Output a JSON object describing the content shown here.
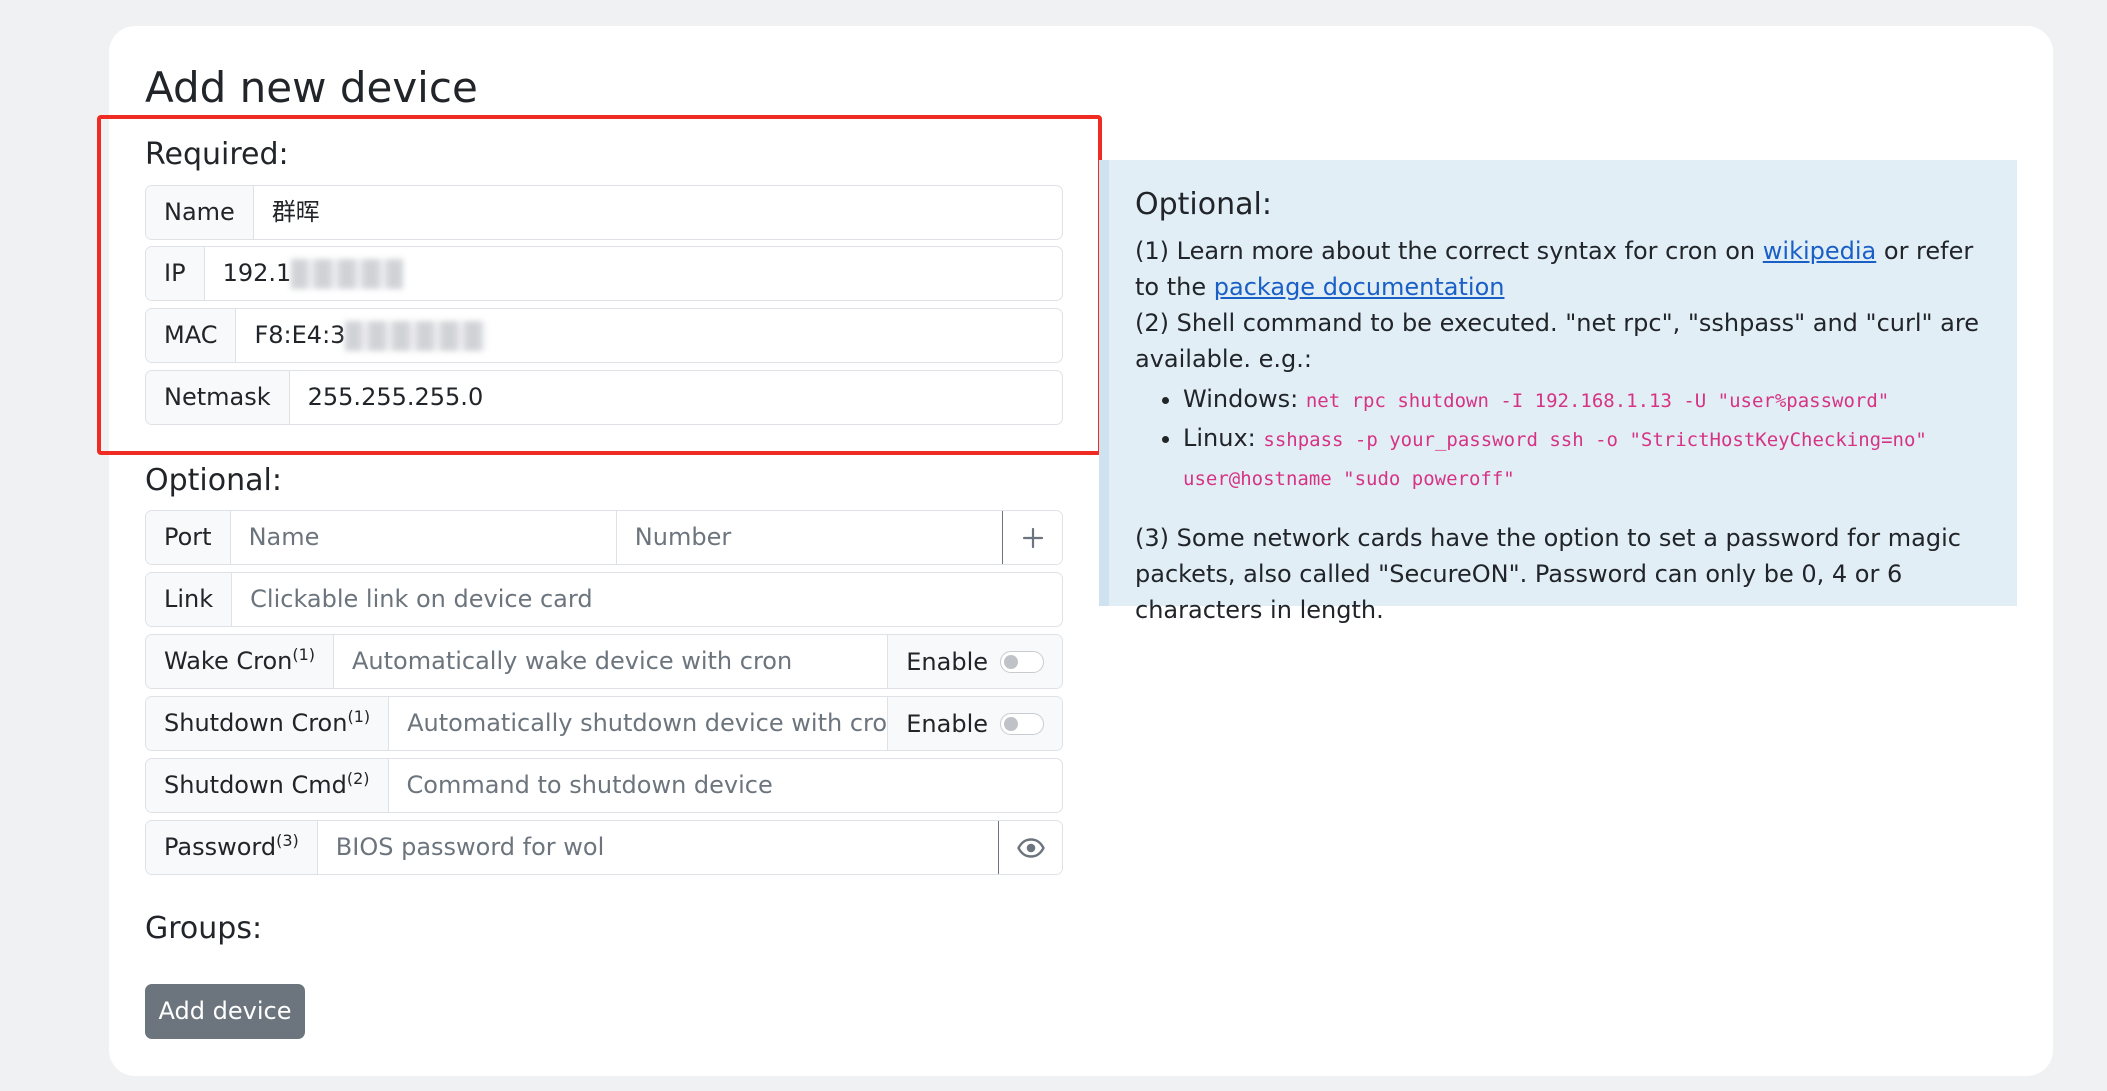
{
  "title": "Add new device",
  "required": {
    "heading": "Required:",
    "name": {
      "label": "Name",
      "value": "群晖"
    },
    "ip": {
      "label": "IP",
      "value": "192.1"
    },
    "mac": {
      "label": "MAC",
      "value": "F8:E4:3"
    },
    "netmask": {
      "label": "Netmask",
      "value": "255.255.255.0"
    }
  },
  "optional": {
    "heading": "Optional:",
    "port": {
      "label": "Port",
      "name_placeholder": "Name",
      "number_placeholder": "Number",
      "add_icon": "plus-icon"
    },
    "link": {
      "label": "Link",
      "placeholder": "Clickable link on device card"
    },
    "wake_cron": {
      "label": "Wake Cron",
      "ref": "(1)",
      "placeholder": "Automatically wake device with cron",
      "toggle_label": "Enable",
      "enabled": false
    },
    "shutdown_cron": {
      "label": "Shutdown Cron",
      "ref": "(1)",
      "placeholder": "Automatically shutdown device with cron",
      "toggle_label": "Enable",
      "enabled": false
    },
    "shutdown_cmd": {
      "label": "Shutdown Cmd",
      "ref": "(2)",
      "placeholder": "Command to shutdown device"
    },
    "password": {
      "label": "Password",
      "ref": "(3)",
      "placeholder": "BIOS password for wol",
      "toggle_icon": "eye-icon"
    }
  },
  "groups_heading": "Groups:",
  "submit_label": "Add device",
  "help": {
    "heading": "Optional:",
    "p1_before": "(1) Learn more about the correct syntax for cron on ",
    "p1_link1": "wikipedia",
    "p1_between": " or refer to the ",
    "p1_link2": "package documentation",
    "p2": "(2) Shell command to be executed. \"net rpc\", \"sshpass\" and \"curl\" are available. e.g.:",
    "windows_label": "Windows: ",
    "windows_cmd": "net rpc shutdown -I 192.168.1.13 -U \"user%password\"",
    "linux_label": "Linux: ",
    "linux_cmd": "sshpass -p your_password ssh -o \"StrictHostKeyChecking=no\" user@hostname \"sudo poweroff\"",
    "p3": "(3) Some network cards have the option to set a password for magic packets, also called \"SecureON\". Password can only be 0, 4 or 6 characters in length."
  },
  "colors": {
    "highlight": "#ef2b22",
    "button": "#6c757d",
    "info_bg": "#e2eef6",
    "code": "#d63384",
    "link": "#1a5fc6"
  }
}
